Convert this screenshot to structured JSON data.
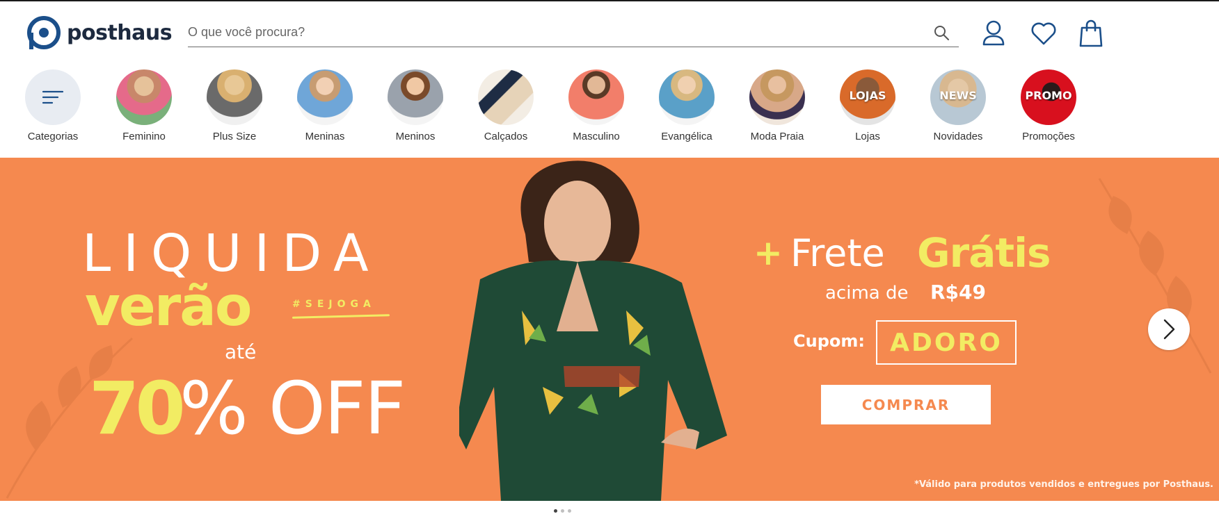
{
  "brand": {
    "name": "posthaus",
    "color": "#1b4f8a"
  },
  "search": {
    "placeholder": "O que você procura?"
  },
  "header_icons": [
    "user-icon",
    "heart-icon",
    "shopping-bag-icon"
  ],
  "categories": [
    {
      "label": "Categorias",
      "icon": "menu-lines-icon"
    },
    {
      "label": "Feminino"
    },
    {
      "label": "Plus Size"
    },
    {
      "label": "Meninas"
    },
    {
      "label": "Meninos"
    },
    {
      "label": "Calçados"
    },
    {
      "label": "Masculino"
    },
    {
      "label": "Evangélica"
    },
    {
      "label": "Moda Praia"
    },
    {
      "label": "Lojas",
      "overlay": "LOJAS"
    },
    {
      "label": "Novidades",
      "overlay": "NEWS"
    },
    {
      "label": "Promoções",
      "overlay": "PROMO"
    }
  ],
  "banner": {
    "line1": "LIQUIDA",
    "line2": "verão",
    "hashtag": "#SEJOGA",
    "ate": "até",
    "percent": "70",
    "off": "% OFF",
    "plus": "+",
    "frete": "Frete",
    "gratis": "Grátis",
    "acima": "acima de",
    "min_value": "R$49",
    "cupom_label": "Cupom:",
    "cupom_code": "ADORO",
    "cta": "COMPRAR",
    "disclaimer": "*Válido para produtos vendidos e entregues por Posthaus.",
    "bg_color": "#f5894f",
    "accent_color": "#f2ec63"
  },
  "carousel": {
    "total_slides": 3,
    "active_slide": 1
  }
}
